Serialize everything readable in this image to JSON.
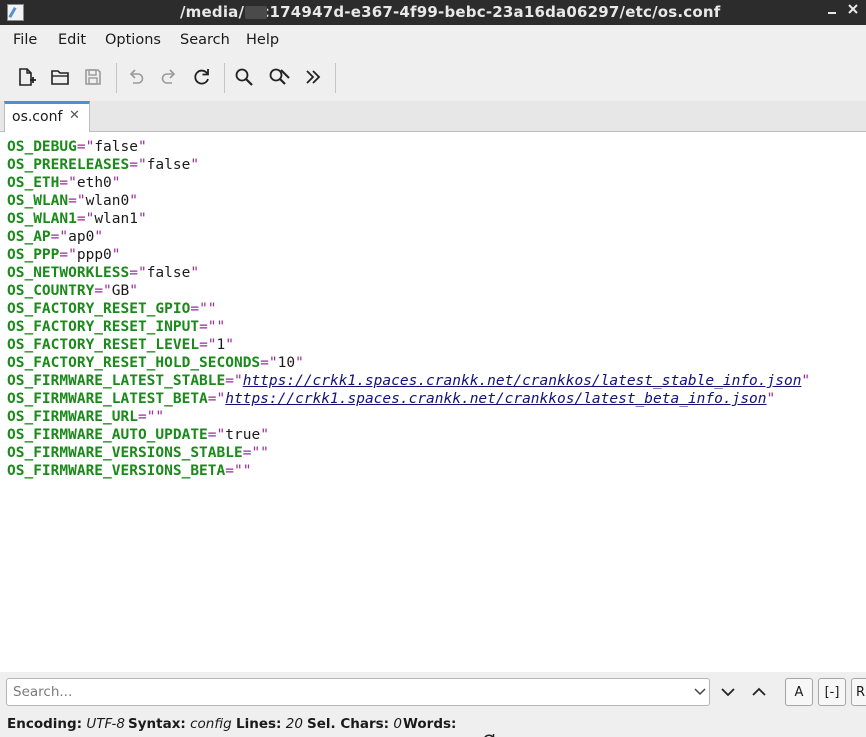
{
  "window": {
    "title": "/media/   c174947d-e367-4f99-bebc-23a16da06297/etc/os.conf",
    "minimize_icon": "minimize-icon",
    "close_icon": "close-icon"
  },
  "menu": {
    "file": "File",
    "edit": "Edit",
    "options": "Options",
    "search": "Search",
    "help": "Help"
  },
  "toolbar": {
    "icons": [
      "new-file-icon",
      "open-folder-icon",
      "save-icon",
      "undo-icon",
      "redo-icon",
      "reload-icon",
      "find-icon",
      "find-replace-icon",
      "more-icon"
    ]
  },
  "tab": {
    "label": "os.conf",
    "close": "✕"
  },
  "editor": {
    "lines": [
      {
        "key": "OS_DEBUG",
        "eq": "=",
        "value": "false"
      },
      {
        "key": "OS_PRERELEASES",
        "eq": "=",
        "value": "false"
      },
      {
        "key": "OS_ETH",
        "eq": "=",
        "value": "eth0"
      },
      {
        "key": "OS_WLAN",
        "eq": "=",
        "value": "wlan0"
      },
      {
        "key": "OS_WLAN1",
        "eq": "=",
        "value": "wlan1"
      },
      {
        "key": "OS_AP",
        "eq": "=",
        "value": "ap0"
      },
      {
        "key": "OS_PPP",
        "eq": "=",
        "value": "ppp0"
      },
      {
        "key": "OS_NETWORKLESS",
        "eq": "=",
        "value": "false"
      },
      {
        "key": "OS_COUNTRY",
        "eq": "=",
        "value": "GB"
      },
      {
        "key": "OS_FACTORY_RESET_GPIO",
        "eq": "=",
        "value": ""
      },
      {
        "key": "OS_FACTORY_RESET_INPUT",
        "eq": "=",
        "value": ""
      },
      {
        "key": "OS_FACTORY_RESET_LEVEL",
        "eq": "=",
        "value": "1"
      },
      {
        "key": "OS_FACTORY_RESET_HOLD_SECONDS",
        "eq": "=",
        "value": "10"
      },
      {
        "key": "OS_FIRMWARE_LATEST_STABLE",
        "eq": "=",
        "value": "https://crkk1.spaces.crankk.net/crankkos/latest_stable_info.json",
        "link": true
      },
      {
        "key": "OS_FIRMWARE_LATEST_BETA",
        "eq": "=",
        "value": "https://crkk1.spaces.crankk.net/crankkos/latest_beta_info.json",
        "link": true
      },
      {
        "key": "OS_FIRMWARE_URL",
        "eq": "=",
        "value": ""
      },
      {
        "key": "OS_FIRMWARE_AUTO_UPDATE",
        "eq": "=",
        "value": "true"
      },
      {
        "key": "OS_FIRMWARE_VERSIONS_STABLE",
        "eq": "=",
        "value": ""
      },
      {
        "key": "OS_FIRMWARE_VERSIONS_BETA",
        "eq": "=",
        "value": ""
      }
    ],
    "quote": "\""
  },
  "search": {
    "placeholder": "Search...",
    "match_case_label": "A",
    "whole_word_label": "[-]",
    "regex_label": "R"
  },
  "status": {
    "encoding_label": "Encoding:",
    "encoding_value": "UTF-8",
    "syntax_label": "Syntax:",
    "syntax_value": "config",
    "lines_label": "Lines:",
    "lines_value": "20",
    "sel_label": "Sel. Chars:",
    "sel_value": "0",
    "words_label": "Words:"
  },
  "colors": {
    "key": "#1b8a1b",
    "operator": "#9c2a9c",
    "link": "#12127a",
    "titlebar": "#2c2c2c",
    "accent": "#4a90d9"
  }
}
